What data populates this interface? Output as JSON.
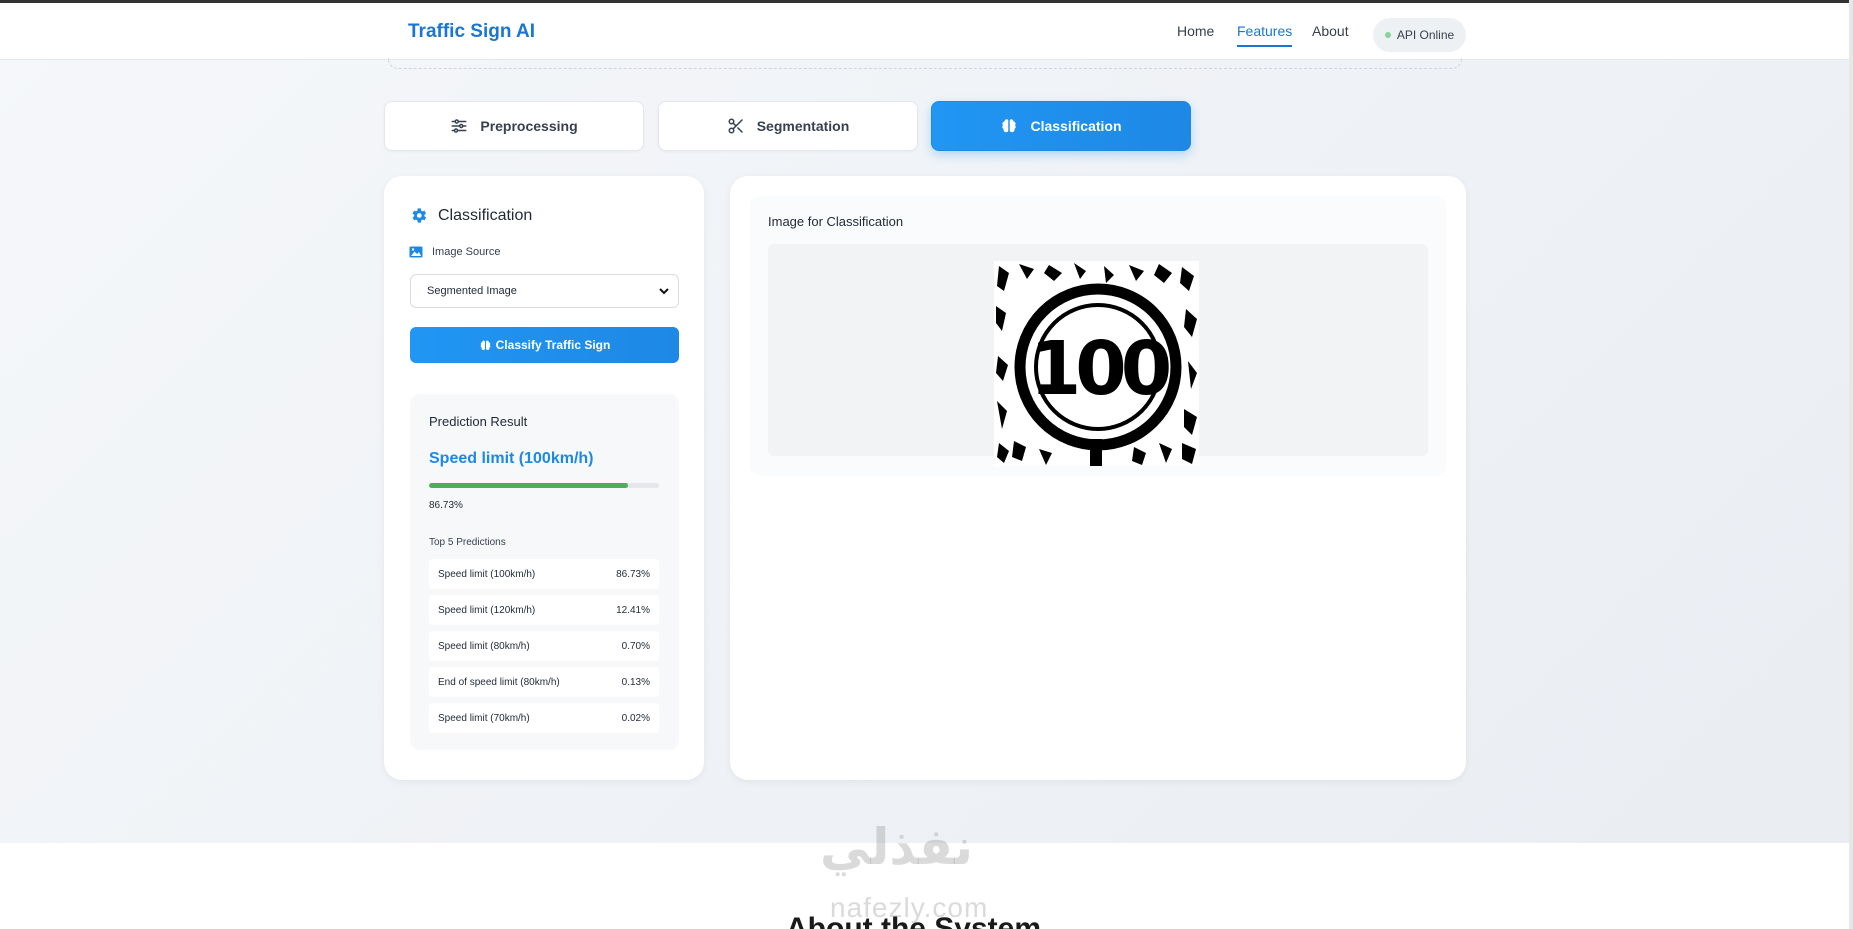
{
  "header": {
    "brand": "Traffic Sign AI",
    "nav": [
      "Home",
      "Features",
      "About"
    ],
    "active_nav": "Features",
    "api_status": "API Online"
  },
  "tabs": [
    {
      "label": "Preprocessing",
      "icon": "sliders-icon"
    },
    {
      "label": "Segmentation",
      "icon": "scissors-icon"
    },
    {
      "label": "Classification",
      "icon": "brain-icon",
      "active": true
    }
  ],
  "left_panel": {
    "title": "Classification",
    "source_label": "Image Source",
    "source_value": "Segmented Image",
    "classify_button": "Classify Traffic Sign",
    "result": {
      "heading": "Prediction Result",
      "prediction": "Speed limit (100km/h)",
      "confidence_text": "86.73%",
      "confidence_fraction": 0.8673,
      "top5_heading": "Top 5 Predictions",
      "top5": [
        {
          "label": "Speed limit (100km/h)",
          "value": "86.73%"
        },
        {
          "label": "Speed limit (120km/h)",
          "value": "12.41%"
        },
        {
          "label": "Speed limit (80km/h)",
          "value": "0.70%"
        },
        {
          "label": "End of speed limit (80km/h)",
          "value": "0.13%"
        },
        {
          "label": "Speed limit (70km/h)",
          "value": "0.02%"
        }
      ]
    }
  },
  "right_panel": {
    "title": "Image for Classification",
    "sign_text": "100"
  },
  "watermark": {
    "arabic": "نفذلي",
    "latin": "nafezly.com"
  },
  "footer_peek": "About the System",
  "colors": {
    "accent": "#1e88e5",
    "success": "#4caf50",
    "api_dot": "#86d39c"
  }
}
